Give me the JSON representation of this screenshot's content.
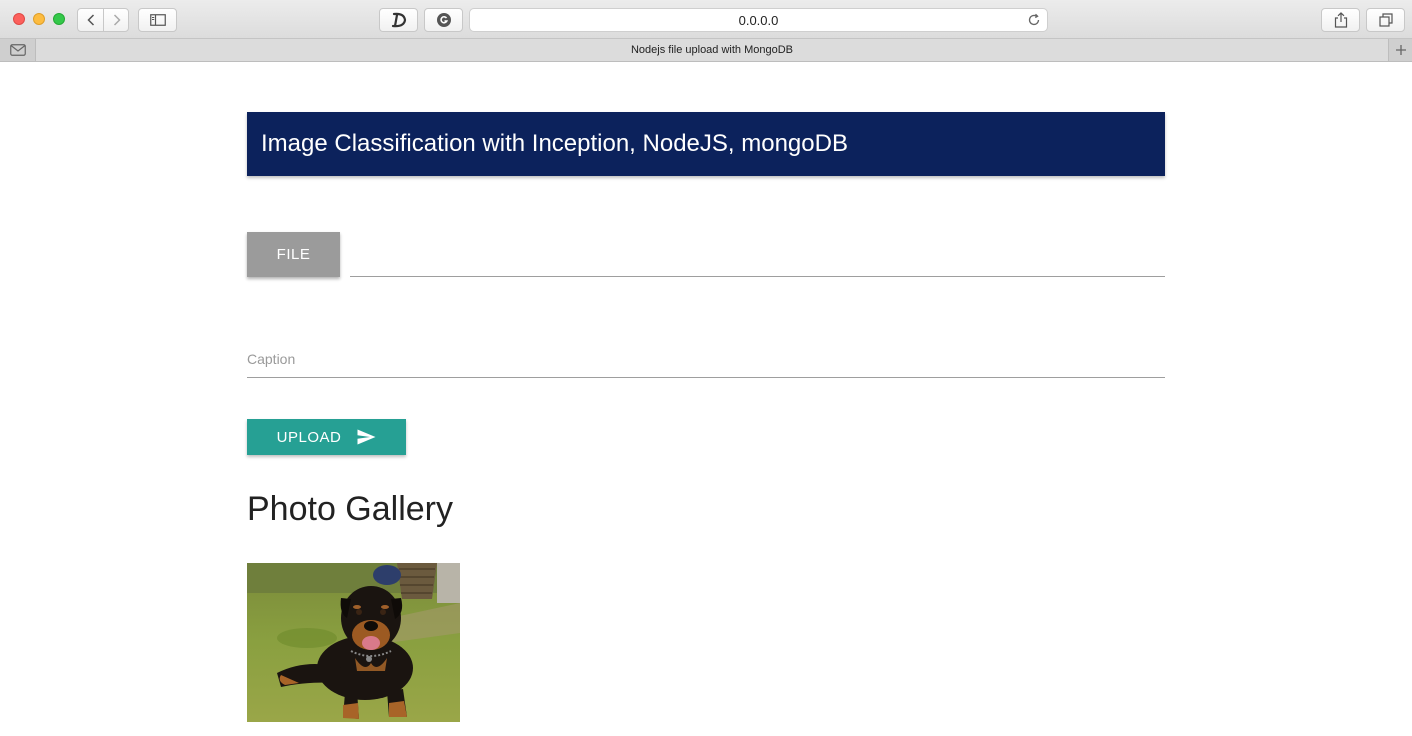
{
  "browser": {
    "url": "0.0.0.0",
    "tab_title": "Nodejs file upload with MongoDB"
  },
  "page": {
    "header_title": "Image Classification with Inception, NodeJS, mongoDB",
    "file_button_label": "FILE",
    "file_path_value": "",
    "caption_placeholder": "Caption",
    "upload_button_label": "UPLOAD",
    "gallery_title": "Photo Gallery"
  },
  "colors": {
    "header_bg": "#0c225c",
    "upload_btn": "#26a094",
    "file_btn": "#9b9b9b"
  },
  "gallery": {
    "items": [
      {
        "kind": "photo",
        "subject": "rottweiler dog lying on grass"
      }
    ]
  }
}
